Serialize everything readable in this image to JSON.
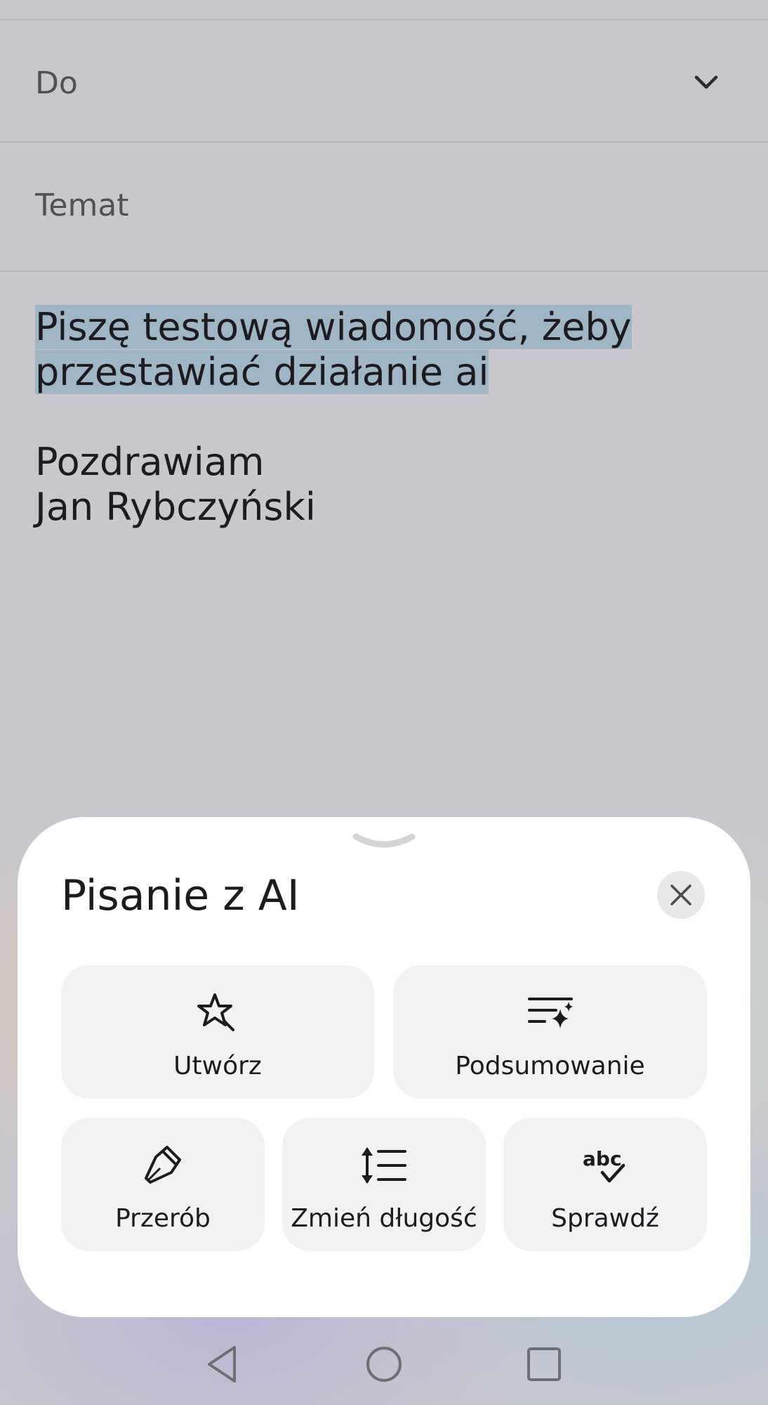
{
  "compose": {
    "to_label": "Do",
    "subject_label": "Temat",
    "body_selected_line1": "Piszę testową wiadomość, żeby",
    "body_selected_line2": "przestawiać działanie ai",
    "signature_line1": "Pozdrawiam",
    "signature_line2": "Jan Rybczyński"
  },
  "ai_sheet": {
    "title": "Pisanie z AI",
    "actions": [
      {
        "label": "Utwórz",
        "icon": "sparkle-star-icon"
      },
      {
        "label": "Podsumowanie",
        "icon": "summary-lines-icon"
      },
      {
        "label": "Przerób",
        "icon": "pen-nib-icon"
      },
      {
        "label": "Zmień długość",
        "icon": "line-spacing-icon"
      },
      {
        "label": "Sprawdź",
        "icon": "spell-check-icon"
      }
    ]
  },
  "colors": {
    "background_dim": "#c9c7cd",
    "selection_highlight": "#9fb6c6",
    "sheet": "#ffffff",
    "action_tile": "#f2f2f3"
  }
}
